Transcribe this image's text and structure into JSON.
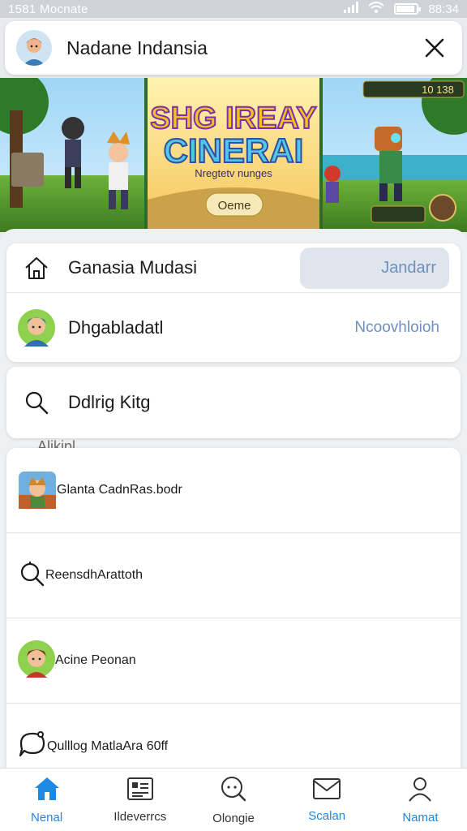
{
  "status_bar": {
    "time": "1581 Mocnate",
    "clock": "88:34",
    "battery_level": 0.9
  },
  "header": {
    "title": "Nadane Indansia",
    "avatar_icon": "user-avatar-icon",
    "close_icon": "close-icon"
  },
  "banner": {
    "title_line1": "SHG IREAY",
    "title_line2": "CINERAI",
    "subtitle": "Nregtetv nunges",
    "badge": "Oeme",
    "hud_value": "10 138"
  },
  "menu": {
    "home_row": {
      "label": "Ganasia Mudasi",
      "chip": "Jandarr",
      "icon": "home-icon"
    },
    "profile_row": {
      "label": "Dhgabladatl",
      "meta": "Ncoovhloioh",
      "icon": "avatar-icon"
    },
    "search_row": {
      "label": "Ddlrig Kitg",
      "icon": "search-icon"
    }
  },
  "section": {
    "label": "Alikipl"
  },
  "list": [
    {
      "label": "Glanta Cadn",
      "meta": "Ras.bodr",
      "icon": "game-avatar-icon"
    },
    {
      "label": "Reensdh",
      "meta": "Arattoth",
      "icon": "search-icon"
    },
    {
      "label": "Acine Peonan",
      "meta": "",
      "icon": "person-avatar-icon"
    },
    {
      "label": "Qulllog Matla",
      "meta": "Ara 60ff",
      "icon": "chat-icon"
    }
  ],
  "bottom_nav": [
    {
      "label": "Nenal",
      "icon": "home-icon",
      "active": true
    },
    {
      "label": "Ildeverrcs",
      "icon": "list-icon",
      "active": false
    },
    {
      "label": "Olongie",
      "icon": "chat-icon",
      "active": false
    },
    {
      "label": "Scalan",
      "icon": "mail-icon",
      "active": false
    },
    {
      "label": "Namat",
      "icon": "person-icon",
      "active": false
    }
  ],
  "colors": {
    "accent": "#1e88e5",
    "meta_text": "#6f8fbf"
  }
}
